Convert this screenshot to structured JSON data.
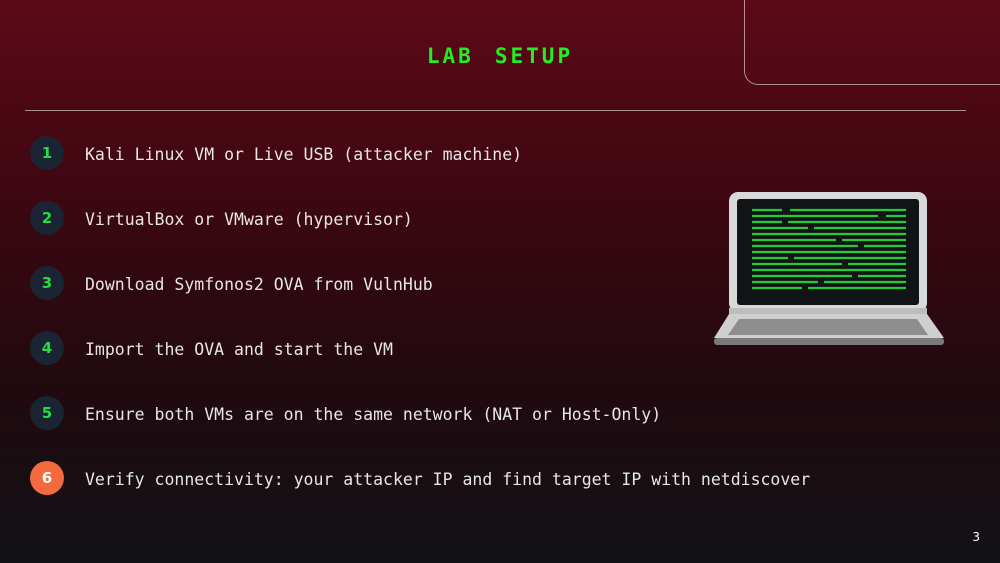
{
  "slide": {
    "title": "Lab Setup",
    "page_number": "3"
  },
  "steps": [
    {
      "number": "1",
      "text": "Kali Linux VM or Live USB (attacker machine)"
    },
    {
      "number": "2",
      "text": "VirtualBox or VMware (hypervisor)"
    },
    {
      "number": "3",
      "text": "Download Symfonos2 OVA from VulnHub"
    },
    {
      "number": "4",
      "text": "Import the OVA and start the VM"
    },
    {
      "number": "5",
      "text": "Ensure both VMs are on the same network (NAT or Host-Only)"
    },
    {
      "number": "6",
      "text": "Verify connectivity: your attacker IP and find target IP with netdiscover"
    }
  ],
  "illustration": {
    "icon": "laptop-terminal-icon"
  },
  "colors": {
    "title": "#22ee22",
    "badge_bg": "#1a2433",
    "badge_text": "#22dd44",
    "badge_active_bg": "#f26a3d",
    "text": "#e6e6e6"
  }
}
